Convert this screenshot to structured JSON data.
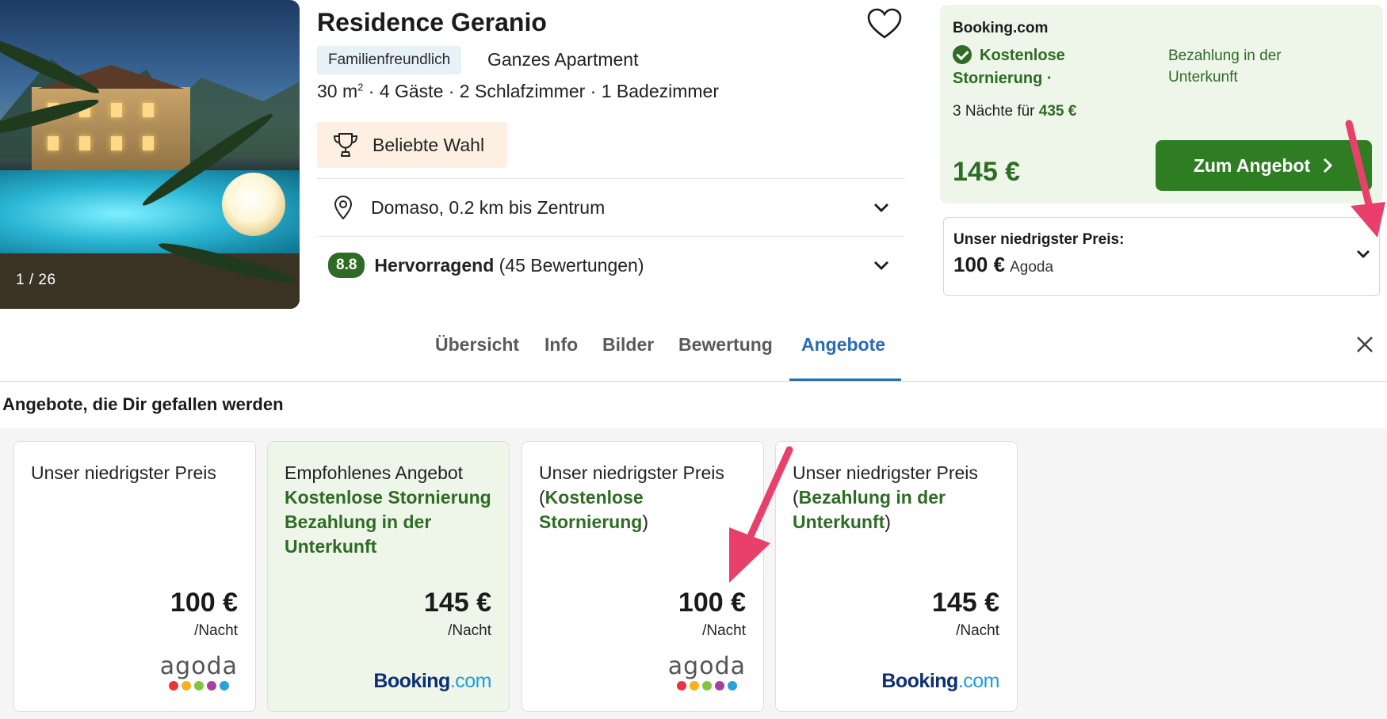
{
  "hero": {
    "counter": "1 / 26"
  },
  "listing": {
    "title": "Residence Geranio",
    "tag": "Familienfreundlich",
    "type": "Ganzes Apartment",
    "area_value": "30 m",
    "area_sup": "2",
    "specs_rest": " · 4 Gäste · 2 Schlafzimmer · 1 Badezimmer",
    "award": "Beliebte Wahl",
    "location": "Domaso, 0.2 km bis Zentrum",
    "rating_score": "8.8",
    "rating_label": "Hervorragend",
    "rating_count": "(45 Bewertungen)"
  },
  "price_panel": {
    "provider": "Booking.com",
    "free_cancel": "Kostenlose Stornierung ·",
    "pay_at_property": "Bezahlung in der Unterkunft",
    "nights_prefix": "3 Nächte für ",
    "nights_total": "435 €",
    "price": "145 €",
    "cta": "Zum Angebot"
  },
  "lowest_price": {
    "title": "Unser niedrigster Preis:",
    "price": "100 €",
    "provider": "Agoda"
  },
  "tabs": [
    {
      "label": "Übersicht",
      "active": false
    },
    {
      "label": "Info",
      "active": false
    },
    {
      "label": "Bilder",
      "active": false
    },
    {
      "label": "Bewertung",
      "active": false
    },
    {
      "label": "Angebote",
      "active": true
    }
  ],
  "offers": {
    "section_title": "Angebote, die Dir gefallen werden",
    "cards": [
      {
        "head": "Unser niedrigster Preis",
        "highlight": "",
        "price": "100 €",
        "unit": "/Nacht",
        "provider": "agoda"
      },
      {
        "head": "Empfohlenes Angebot",
        "highlight_a": "Kostenlose Stornierung",
        "highlight_b": "Bezahlung in der Unterkunft",
        "price": "145 €",
        "unit": "/Nacht",
        "provider": "Booking.com"
      },
      {
        "head": "Unser niedrigster Preis",
        "highlight": "Kostenlose Stornierung",
        "open": "(",
        "close": ")",
        "price": "100 €",
        "unit": "/Nacht",
        "provider": "agoda"
      },
      {
        "head": "Unser niedrigster Preis",
        "highlight": "Bezahlung in der Unterkunft",
        "open": "(",
        "close": ")",
        "price": "145 €",
        "unit": "/Nacht",
        "provider": "Booking.com"
      }
    ]
  },
  "logos": {
    "agoda_text": "agoda",
    "booking_main": "Booking",
    "booking_dot": ".com",
    "agoda_dot_colors": [
      "#e7343f",
      "#f6b21b",
      "#84c341",
      "#a3449a",
      "#2aa0dc"
    ]
  },
  "colors": {
    "green": "#2e6b24",
    "cta": "#2e7d23",
    "blue_active": "#2a6bb5",
    "arrow": "#e8406b",
    "panel_bg": "#eef6ea"
  }
}
